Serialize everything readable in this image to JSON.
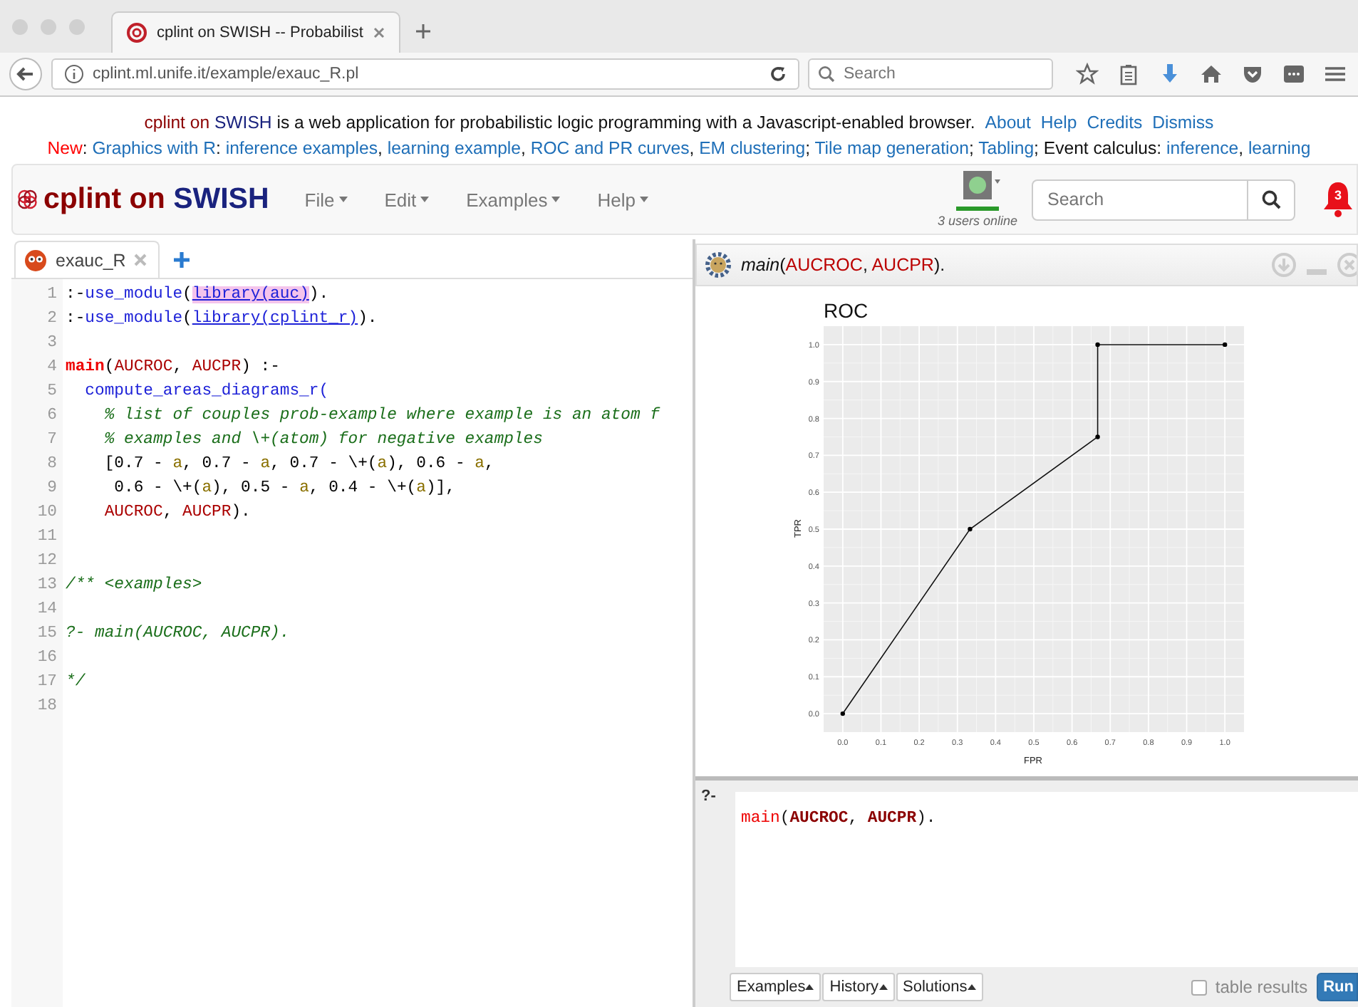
{
  "browser": {
    "tab_title": "cplint on SWISH -- Probabilist",
    "url": "cplint.ml.unife.it/example/exauc_R.pl",
    "search_placeholder": "Search"
  },
  "notice": [
    [
      {
        "text": "cplint on ",
        "kind": "brand"
      },
      {
        "text": "SWISH",
        "kind": "brand2"
      },
      {
        "text": " is a web application for probabilistic logic programming with a Javascript-enabled browser.",
        "kind": "text"
      },
      {
        "text": "About",
        "kind": "action"
      },
      {
        "text": "Help",
        "kind": "action"
      },
      {
        "text": "Credits",
        "kind": "action"
      },
      {
        "text": "Dismiss",
        "kind": "action"
      }
    ],
    [
      {
        "text": "New",
        "kind": "new"
      },
      {
        "text": ": ",
        "kind": "text"
      },
      {
        "text": "Graphics with R",
        "kind": "link"
      },
      {
        "text": ": ",
        "kind": "text"
      },
      {
        "text": "inference examples",
        "kind": "link"
      },
      {
        "text": ", ",
        "kind": "text"
      },
      {
        "text": "learning example",
        "kind": "link"
      },
      {
        "text": ", ",
        "kind": "text"
      },
      {
        "text": "ROC and PR curves",
        "kind": "link"
      },
      {
        "text": ", ",
        "kind": "text"
      },
      {
        "text": "EM clustering",
        "kind": "link"
      },
      {
        "text": "; ",
        "kind": "text"
      },
      {
        "text": "Tile map generation",
        "kind": "link"
      },
      {
        "text": "; ",
        "kind": "text"
      },
      {
        "text": "Tabling",
        "kind": "link"
      },
      {
        "text": "; Event calculus: ",
        "kind": "text"
      },
      {
        "text": "inference",
        "kind": "link"
      },
      {
        "text": ", ",
        "kind": "text"
      },
      {
        "text": "learning",
        "kind": "link"
      }
    ]
  ],
  "navbar": {
    "brand": [
      {
        "text": "cplint on ",
        "kind": "brand"
      },
      {
        "text": "SWISH",
        "kind": "brand2"
      }
    ],
    "menus": [
      "File",
      "Edit",
      "Examples",
      "Help"
    ],
    "users_online": "3 users online",
    "search_placeholder": "Search",
    "notifications": "3"
  },
  "editor": {
    "tabs": [
      {
        "label": "exauc_R",
        "selected": true
      }
    ],
    "lines": [
      {
        "number": "1",
        "tokens": [
          {
            "text": ":-",
            "kind": "punct"
          },
          {
            "text": "use_module",
            "kind": "builtin"
          },
          {
            "text": "(",
            "kind": "punct"
          },
          {
            "text": "library(auc)",
            "kind": "link",
            "highlighted": true
          },
          {
            "text": ").",
            "kind": "punct"
          }
        ]
      },
      {
        "number": "2",
        "tokens": [
          {
            "text": ":-",
            "kind": "punct"
          },
          {
            "text": "use_module",
            "kind": "builtin"
          },
          {
            "text": "(",
            "kind": "punct"
          },
          {
            "text": "library(cplint_r)",
            "kind": "link",
            "highlighted": false
          },
          {
            "text": ").",
            "kind": "punct"
          }
        ]
      },
      {
        "number": "3"
      },
      {
        "number": "4",
        "tokens": [
          {
            "text": "main",
            "kind": "head"
          },
          {
            "text": "(",
            "kind": "punct"
          },
          {
            "text": "AUCROC",
            "kind": "var"
          },
          {
            "text": ", ",
            "kind": "punct"
          },
          {
            "text": "AUCPR",
            "kind": "var"
          },
          {
            "text": ") :-",
            "kind": "punct"
          }
        ]
      },
      {
        "number": "5",
        "tokens": [
          {
            "text": "  compute_areas_diagrams_r(",
            "kind": "builtin"
          }
        ]
      },
      {
        "number": "6",
        "tokens": [
          {
            "text": "    % list of couples prob-example where example is an atom f",
            "kind": "comment"
          }
        ]
      },
      {
        "number": "7",
        "tokens": [
          {
            "text": "    % examples and \\+(atom) for negative examples",
            "kind": "comment"
          }
        ]
      },
      {
        "number": "8",
        "tokens": [
          {
            "text": "    [0.7 - ",
            "kind": "punct"
          },
          {
            "text": "a",
            "kind": "atom"
          },
          {
            "text": ", 0.7 - ",
            "kind": "punct"
          },
          {
            "text": "a",
            "kind": "atom"
          },
          {
            "text": ", 0.7 - \\+(",
            "kind": "punct"
          },
          {
            "text": "a",
            "kind": "atom"
          },
          {
            "text": "), 0.6 - ",
            "kind": "punct"
          },
          {
            "text": "a",
            "kind": "atom"
          },
          {
            "text": ",",
            "kind": "punct"
          }
        ]
      },
      {
        "number": "9",
        "tokens": [
          {
            "text": "     0.6 - \\+(",
            "kind": "punct"
          },
          {
            "text": "a",
            "kind": "atom"
          },
          {
            "text": "), 0.5 - ",
            "kind": "punct"
          },
          {
            "text": "a",
            "kind": "atom"
          },
          {
            "text": ", 0.4 - \\+(",
            "kind": "punct"
          },
          {
            "text": "a",
            "kind": "atom"
          },
          {
            "text": ")],",
            "kind": "punct"
          }
        ]
      },
      {
        "number": "10",
        "tokens": [
          {
            "text": "    AUCROC",
            "kind": "var"
          },
          {
            "text": ", ",
            "kind": "punct"
          },
          {
            "text": "AUCPR",
            "kind": "var"
          },
          {
            "text": ").",
            "kind": "punct"
          }
        ]
      },
      {
        "number": "11"
      },
      {
        "number": "12"
      },
      {
        "number": "13",
        "tokens": [
          {
            "text": "/** <examples>",
            "kind": "comment"
          }
        ]
      },
      {
        "number": "14"
      },
      {
        "number": "15",
        "tokens": [
          {
            "text": "?- main(AUCROC, AUCPR).",
            "kind": "comment"
          }
        ]
      },
      {
        "number": "16"
      },
      {
        "number": "17",
        "tokens": [
          {
            "text": "*/",
            "kind": "comment"
          }
        ]
      },
      {
        "number": "18"
      }
    ]
  },
  "answer": {
    "query": [
      {
        "text": "main",
        "kind": "functor"
      },
      {
        "text": "(",
        "kind": "punct"
      },
      {
        "text": "AUCROC",
        "kind": "var"
      },
      {
        "text": ", ",
        "kind": "punct"
      },
      {
        "text": "AUCPR",
        "kind": "var"
      },
      {
        "text": ").",
        "kind": "punct"
      }
    ],
    "chart_data": {
      "type": "line",
      "title": "ROC",
      "xlabel": "FPR",
      "ylabel": "TPR",
      "x": [
        0,
        0.333,
        0.667,
        0.667,
        1
      ],
      "values": [
        0,
        0.5,
        0.75,
        1,
        1
      ],
      "grid": true,
      "marker": true,
      "xlim": [
        -0.05,
        1.05
      ],
      "ylim": [
        -0.05,
        1.05
      ],
      "xticks": [
        {
          "value": 0,
          "label": "0.0"
        },
        {
          "value": 0.1,
          "label": "0.1"
        },
        {
          "value": 0.2,
          "label": "0.2"
        },
        {
          "value": 0.3,
          "label": "0.3"
        },
        {
          "value": 0.4,
          "label": "0.4"
        },
        {
          "value": 0.5,
          "label": "0.5"
        },
        {
          "value": 0.6,
          "label": "0.6"
        },
        {
          "value": 0.7,
          "label": "0.7"
        },
        {
          "value": 0.8,
          "label": "0.8"
        },
        {
          "value": 0.9,
          "label": "0.9"
        },
        {
          "value": 1,
          "label": "1.0"
        }
      ],
      "yticks": [
        {
          "value": 0,
          "label": "0.0"
        },
        {
          "value": 0.1,
          "label": "0.1"
        },
        {
          "value": 0.2,
          "label": "0.2"
        },
        {
          "value": 0.3,
          "label": "0.3"
        },
        {
          "value": 0.4,
          "label": "0.4"
        },
        {
          "value": 0.5,
          "label": "0.5"
        },
        {
          "value": 0.6,
          "label": "0.6"
        },
        {
          "value": 0.7,
          "label": "0.7"
        },
        {
          "value": 0.8,
          "label": "0.8"
        },
        {
          "value": 0.9,
          "label": "0.9"
        },
        {
          "value": 1,
          "label": "1.0"
        }
      ]
    }
  },
  "query": {
    "prompt": "?-",
    "tokens": [
      {
        "text": "main",
        "kind": "head"
      },
      {
        "text": "(",
        "kind": "punct"
      },
      {
        "text": "AUCROC",
        "kind": "var"
      },
      {
        "text": ", ",
        "kind": "punct"
      },
      {
        "text": "AUCPR",
        "kind": "var"
      },
      {
        "text": ").",
        "kind": "punct"
      }
    ],
    "buttons": [
      "Examples",
      "History",
      "Solutions"
    ],
    "table_results": {
      "label": "table results",
      "checked": false
    },
    "run_button": "Run"
  }
}
